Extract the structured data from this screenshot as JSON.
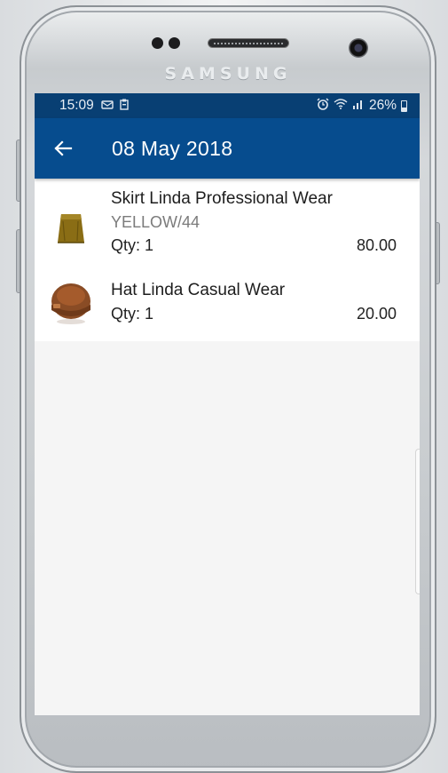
{
  "device": {
    "brand": "SAMSUNG"
  },
  "status_bar": {
    "time": "15:09",
    "battery": "26%"
  },
  "app_bar": {
    "title": "08 May 2018",
    "back_icon": "arrow-left-icon"
  },
  "order_items": [
    {
      "name": "Skirt Linda Professional Wear",
      "variant": "YELLOW/44",
      "qty_label": "Qty: 1",
      "price": "80.00",
      "thumbnail": "skirt-thumbnail"
    },
    {
      "name": "Hat Linda Casual Wear",
      "qty_label": "Qty: 1",
      "price": "20.00",
      "thumbnail": "hat-thumbnail"
    }
  ],
  "colors": {
    "status_bar": "#083f73",
    "app_bar": "#064c8e",
    "background": "#f5f5f5"
  }
}
